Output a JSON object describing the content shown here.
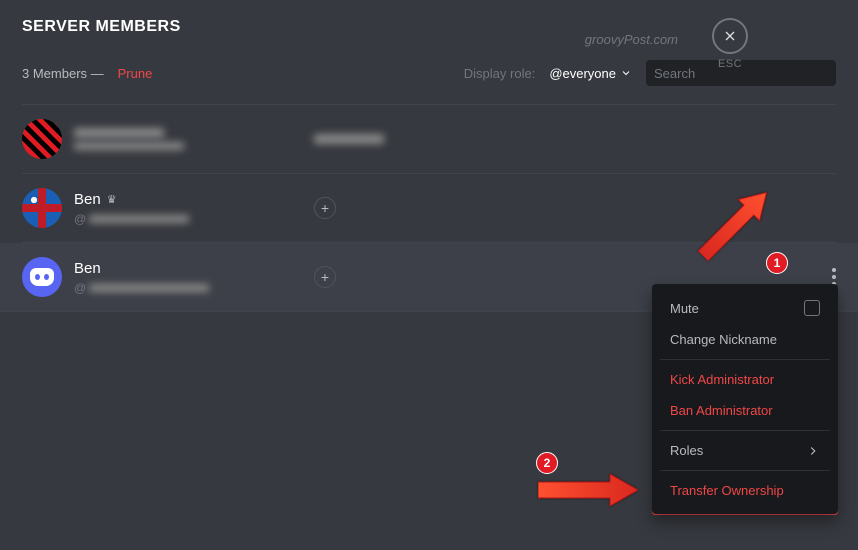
{
  "header": {
    "title": "SERVER MEMBERS",
    "esc": "ESC"
  },
  "watermark": "groovyPost.com",
  "subheader": {
    "count_text": "3 Members —",
    "prune": "Prune",
    "display_role_label": "Display role:",
    "role_selected": "@everyone",
    "search_placeholder": "Search"
  },
  "members": [
    {
      "name_hidden": true,
      "sub_prefix": ""
    },
    {
      "name": "Ben",
      "owner": true,
      "sub_prefix": "@"
    },
    {
      "name": "Ben",
      "owner": false,
      "sub_prefix": "@"
    }
  ],
  "menu": {
    "mute": "Mute",
    "change_nickname": "Change Nickname",
    "kick": "Kick Administrator",
    "ban": "Ban Administrator",
    "roles": "Roles",
    "transfer": "Transfer Ownership"
  },
  "annotations": {
    "step1": "1",
    "step2": "2"
  }
}
